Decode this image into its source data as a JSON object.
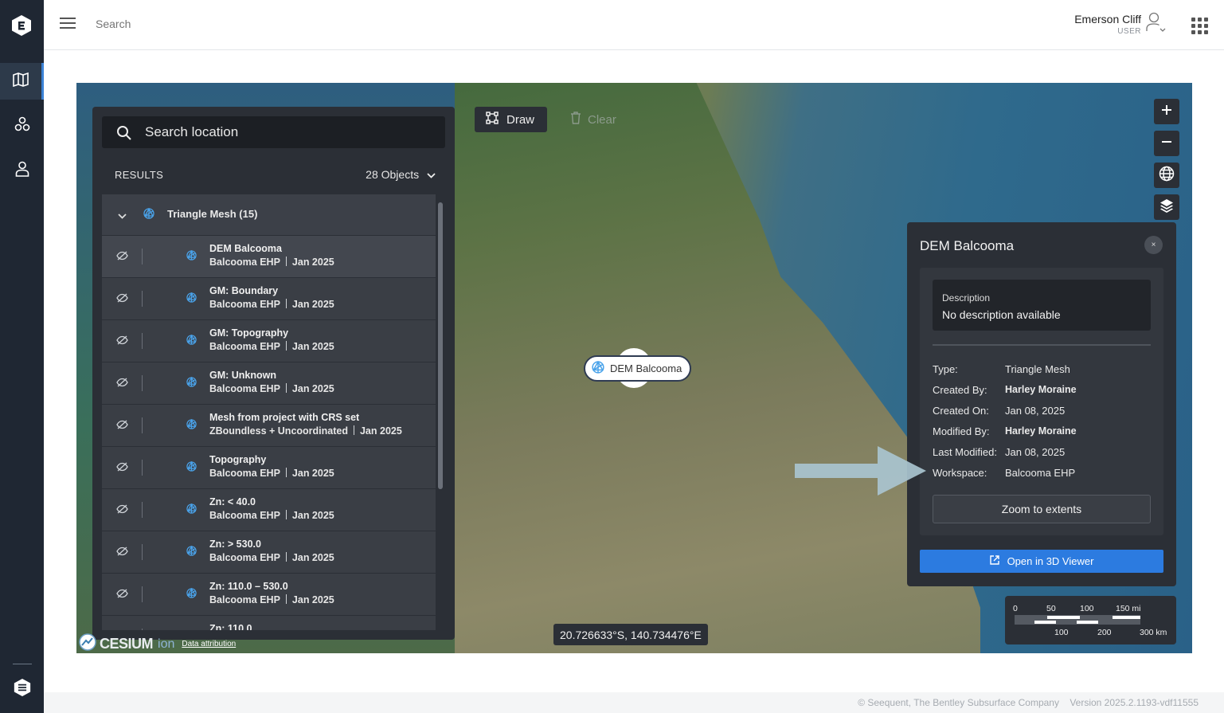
{
  "header": {
    "search_placeholder": "Search",
    "user_name": "Emerson Cliff",
    "user_role": "USER"
  },
  "sidebar": {
    "items": [
      {
        "icon": "map-icon",
        "active": true
      },
      {
        "icon": "objects-icon",
        "active": false
      },
      {
        "icon": "person-icon",
        "active": false
      }
    ]
  },
  "results": {
    "search_placeholder": "Search location",
    "label": "RESULTS",
    "count": "28 Objects",
    "group": "Triangle Mesh (15)",
    "items": [
      {
        "title": "DEM Balcooma",
        "workspace": "Balcooma EHP",
        "date": "Jan 2025"
      },
      {
        "title": "GM: Boundary",
        "workspace": "Balcooma EHP",
        "date": "Jan 2025"
      },
      {
        "title": "GM: Topography",
        "workspace": "Balcooma EHP",
        "date": "Jan 2025"
      },
      {
        "title": "GM: Unknown",
        "workspace": "Balcooma EHP",
        "date": "Jan 2025"
      },
      {
        "title": "Mesh from project with CRS set",
        "workspace": "ZBoundless + Uncoordinated",
        "date": "Jan 2025"
      },
      {
        "title": "Topography",
        "workspace": "Balcooma EHP",
        "date": "Jan 2025"
      },
      {
        "title": "Zn: < 40.0",
        "workspace": "Balcooma EHP",
        "date": "Jan 2025"
      },
      {
        "title": "Zn: > 530.0",
        "workspace": "Balcooma EHP",
        "date": "Jan 2025"
      },
      {
        "title": "Zn: 110.0 – 530.0",
        "workspace": "Balcooma EHP",
        "date": "Jan 2025"
      },
      {
        "title": "Zn: 110.0",
        "workspace": "",
        "date": ""
      }
    ]
  },
  "map": {
    "draw_label": "Draw",
    "clear_label": "Clear",
    "marker_label": "DEM Balcooma",
    "coords": "20.726633°S, 140.734476°E",
    "cesium_brand": "CESIUM",
    "cesium_ion": "ion",
    "attribution": "Data attribution",
    "controls": [
      "zoom-in-icon",
      "zoom-out-icon",
      "globe-icon",
      "layers-icon"
    ]
  },
  "details": {
    "title": "DEM Balcooma",
    "close": "×",
    "description_label": "Description",
    "description_value": "No description available",
    "props": [
      {
        "key": "Type:",
        "value": "Triangle Mesh",
        "strong": false
      },
      {
        "key": "Created By:",
        "value": "Harley Moraine",
        "strong": true
      },
      {
        "key": "Created On:",
        "value": "Jan 08, 2025",
        "strong": false
      },
      {
        "key": "Modified By:",
        "value": "Harley Moraine",
        "strong": true
      },
      {
        "key": "Last Modified:",
        "value": "Jan 08, 2025",
        "strong": false
      },
      {
        "key": "Workspace:",
        "value": "Balcooma EHP",
        "strong": false
      }
    ],
    "zoom_label": "Zoom to extents",
    "open3d_label": "Open in 3D Viewer"
  },
  "scale": {
    "top": [
      "0",
      "50",
      "100",
      "150 mi"
    ],
    "bottom": [
      "100",
      "200",
      "300 km"
    ]
  },
  "footer": {
    "copyright": "© Seequent, The Bentley Subsurface Company",
    "version": "Version 2025.2.1193-vdf11555"
  },
  "colors": {
    "rail": "#1f2733",
    "panel": "#2b2f36",
    "accent": "#2c7be0",
    "mesh_icon": "#4aa3ea"
  }
}
